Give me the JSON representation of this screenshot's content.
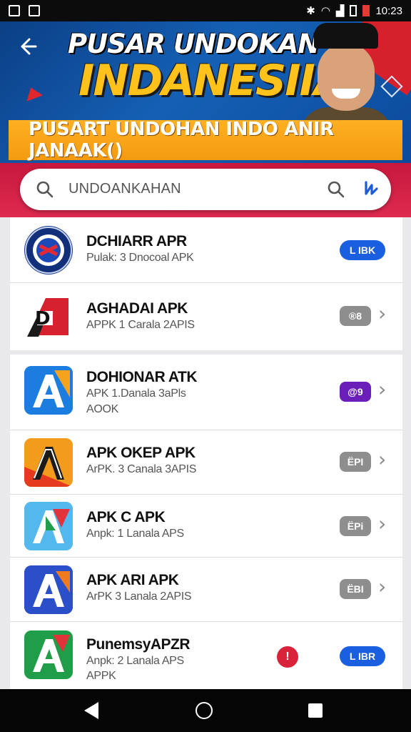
{
  "status_bar": {
    "time": "10:23"
  },
  "banner": {
    "title_line1": "PUSAR UNDOKAN",
    "title_line2": "INDANESIIA",
    "strip_text": "PUSART UNDOHAN  INDO ANIR JANAAK()"
  },
  "search": {
    "placeholder": "UNDOANKAHAN"
  },
  "apps": [
    {
      "title": "DCHIARR APR",
      "subtitle": "Pulak: 3 Dnocoal  APK",
      "subtitle2": "",
      "badge": "L IBK",
      "badge_style": "blue"
    },
    {
      "title": "AGHADAI APK",
      "subtitle": "APPK 1 Carala  2APIS",
      "subtitle2": "",
      "badge": "®8",
      "badge_style": "gray"
    },
    {
      "title": "DOHIONAR ATK",
      "subtitle": "APK 1.Danala  3aPls",
      "subtitle2": "AOOK",
      "badge": "@9",
      "badge_style": "purple"
    },
    {
      "title": "APK OKEP APK",
      "subtitle": "ArPK. 3 Canala  3APIS",
      "subtitle2": "",
      "badge": "ЁPI",
      "badge_style": "gray"
    },
    {
      "title": "APK C APK",
      "subtitle": "Anpk: 1 Lanala  APS",
      "subtitle2": "",
      "badge": "ЁPi",
      "badge_style": "gray"
    },
    {
      "title": "APK ARI APK",
      "subtitle": "ArPK 3 Lanala  2APIS",
      "subtitle2": "",
      "badge": "ЁBI",
      "badge_style": "gray"
    },
    {
      "title": "PunemsyAPZR",
      "subtitle": "Anpk: 2 Lanala  APS",
      "subtitle2": "APPK",
      "badge": "L IBR",
      "badge_style": "blue",
      "alert": "!"
    }
  ],
  "colors": {
    "banner_blue": "#1560b5",
    "search_band": "#d41f45",
    "badge_blue": "#1a5fe0",
    "badge_purple": "#6a1fb8",
    "badge_gray": "#8e8e8e",
    "strip_orange": "#f5a116"
  }
}
